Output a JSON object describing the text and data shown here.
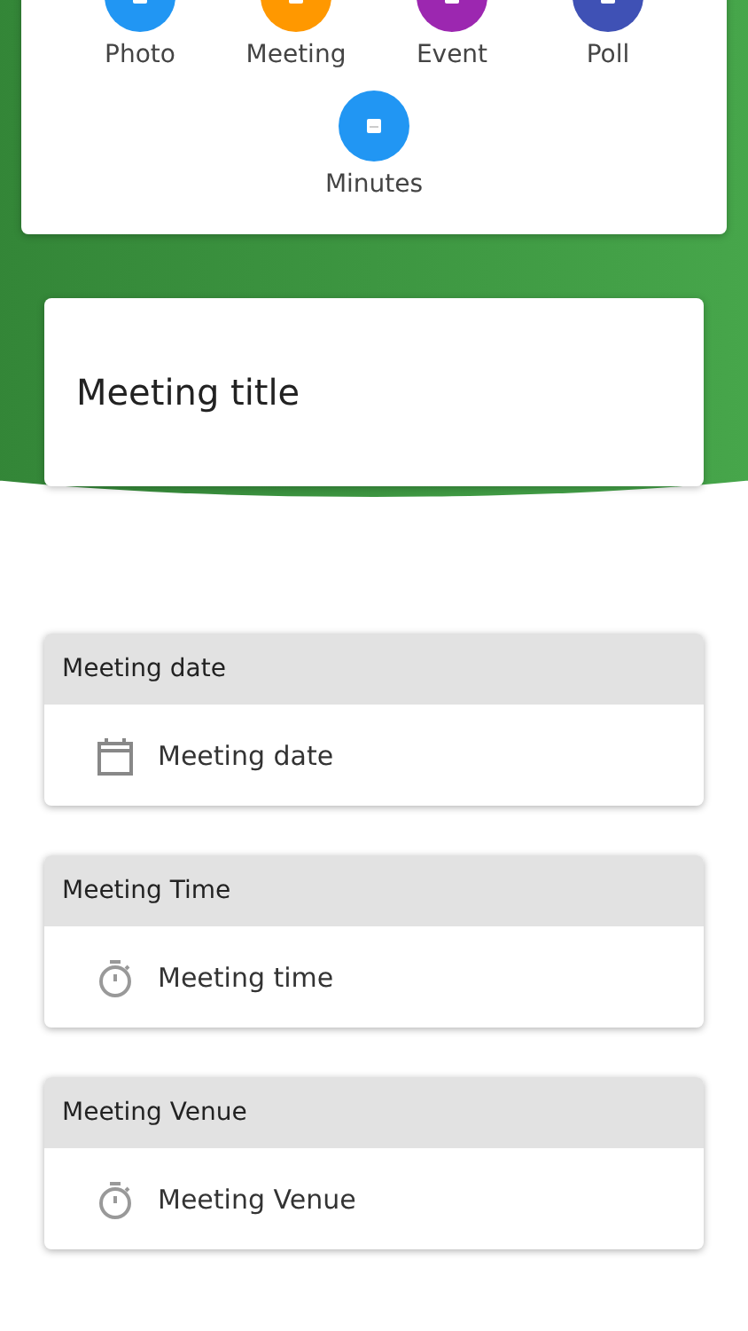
{
  "post_types": [
    {
      "label": "Photo",
      "color": "#2196f3"
    },
    {
      "label": "Meeting",
      "color": "#ff9800"
    },
    {
      "label": "Event",
      "color": "#9c27b0"
    },
    {
      "label": "Poll",
      "color": "#3f51b5"
    },
    {
      "label": "Minutes",
      "color": "#2196f3"
    }
  ],
  "title_field": {
    "placeholder": "Meeting title"
  },
  "sections": [
    {
      "heading": "Meeting date",
      "kind": "calendar",
      "placeholder": "Meeting date"
    },
    {
      "heading": "Meeting Time",
      "kind": "timer",
      "placeholder": "Meeting time"
    },
    {
      "heading": "Meeting Venue",
      "kind": "timer",
      "placeholder": "Meeting Venue"
    }
  ]
}
